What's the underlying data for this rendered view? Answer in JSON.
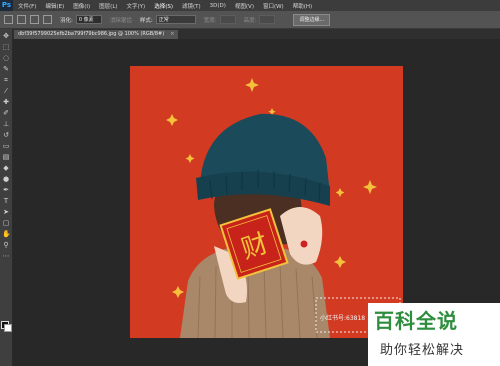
{
  "app": {
    "logo": "Ps"
  },
  "menu": {
    "items": [
      "文件(F)",
      "编辑(E)",
      "图像(I)",
      "图层(L)",
      "文字(Y)",
      "选择(S)",
      "滤镜(T)",
      "3D(D)",
      "视图(V)",
      "窗口(W)",
      "帮助(H)"
    ],
    "highlighted_index": 5
  },
  "options": {
    "feather_label": "羽化:",
    "feather_value": "0 像素",
    "antialias_label": "消除锯齿",
    "style_label": "样式:",
    "style_value": "正常",
    "width_label": "宽度:",
    "height_label": "高度:",
    "refine_edge_button": "调整边缘..."
  },
  "document": {
    "tab_title": "dbf39f5799025efb2ba799f79bc986.jpg @ 100% (RGB/8#)",
    "close_glyph": "×"
  },
  "colors": {
    "accent": "#31a8ff",
    "canvas_background": "#d33a22",
    "annotation_arrow": "#e02020",
    "watermark_green": "#2e8e3e"
  },
  "canvas": {
    "card_character": "财",
    "card_caption": "小红书号:63818"
  },
  "watermark": {
    "title": "百科全说",
    "subtitle": "助你轻松解决"
  }
}
